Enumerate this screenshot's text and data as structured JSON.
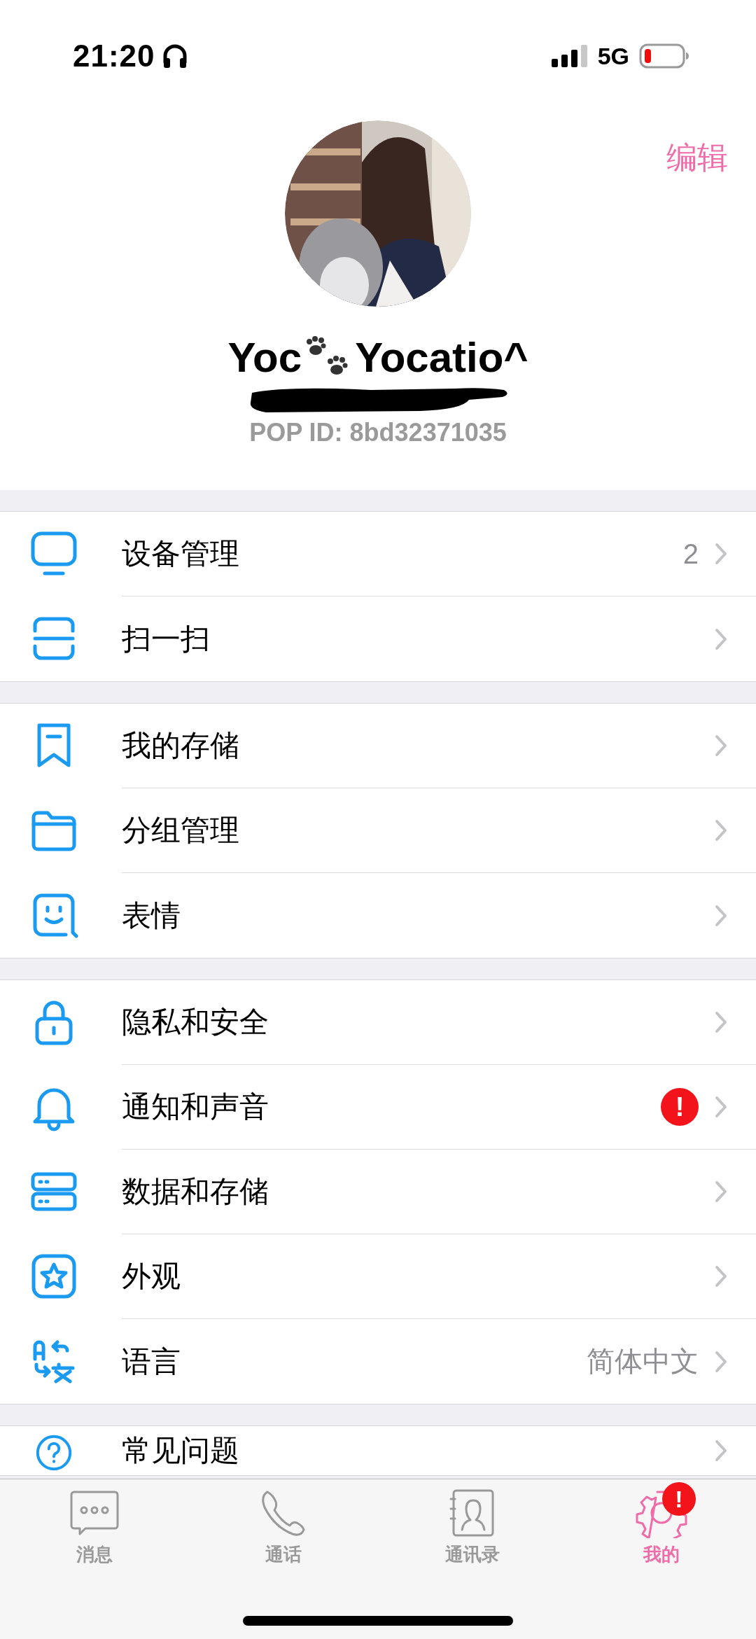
{
  "status_bar": {
    "time": "21:20",
    "network": "5G"
  },
  "profile": {
    "edit": "编辑",
    "name_before": "Yoc",
    "name_after": "Yocatio^",
    "pop_id": "POP ID: 8bd32371035"
  },
  "sections": [
    {
      "rows": [
        {
          "kind": "monitor",
          "label": "设备管理",
          "value": "2"
        },
        {
          "kind": "scan",
          "label": "扫一扫"
        }
      ]
    },
    {
      "rows": [
        {
          "kind": "bookmark",
          "label": "我的存储"
        },
        {
          "kind": "folder",
          "label": "分组管理"
        },
        {
          "kind": "face",
          "label": "表情"
        }
      ]
    },
    {
      "rows": [
        {
          "kind": "lock",
          "label": "隐私和安全"
        },
        {
          "kind": "bell",
          "label": "通知和声音",
          "badge": "!"
        },
        {
          "kind": "server",
          "label": "数据和存储"
        },
        {
          "kind": "star",
          "label": "外观"
        },
        {
          "kind": "translate",
          "label": "语言",
          "value": "简体中文"
        }
      ]
    },
    {
      "rows": [
        {
          "kind": "question",
          "label": "常见问题"
        }
      ]
    }
  ],
  "tab_bar": [
    {
      "kind": "chat",
      "label": "消息",
      "selected": false
    },
    {
      "kind": "phone",
      "label": "通话",
      "selected": false
    },
    {
      "kind": "contact",
      "label": "通讯录",
      "selected": false
    },
    {
      "kind": "gear",
      "label": "我的",
      "selected": true,
      "badge": "!"
    }
  ]
}
